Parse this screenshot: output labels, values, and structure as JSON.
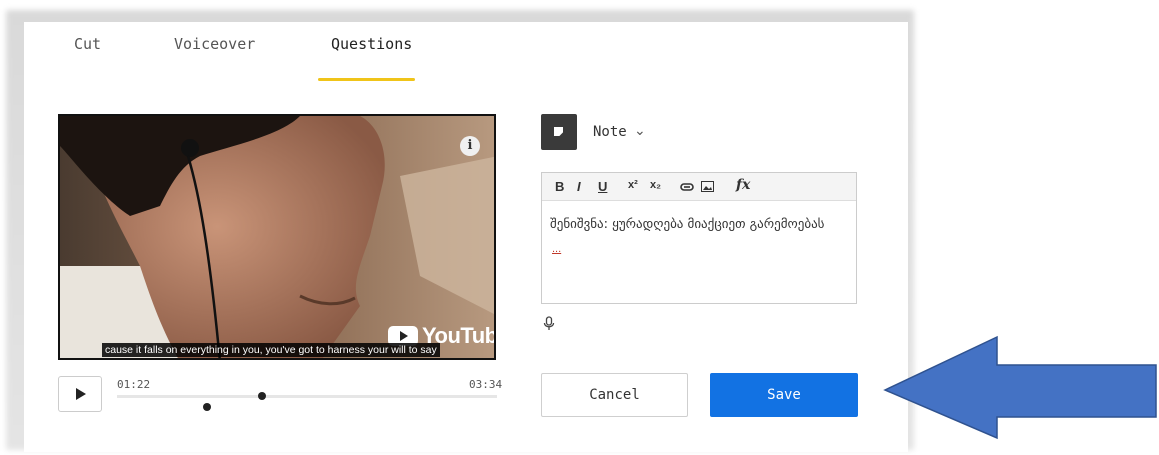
{
  "tabs": [
    {
      "label": "Cut",
      "active": false
    },
    {
      "label": "Voiceover",
      "active": false
    },
    {
      "label": "Questions",
      "active": true
    }
  ],
  "video": {
    "caption": "cause it falls on everything in you, you've got to harness your will to say",
    "youtube_label": "YouTube",
    "info_label": "i"
  },
  "player": {
    "current_time": "01:22",
    "total_time": "03:34"
  },
  "note": {
    "type_label": "Note",
    "toolbar": {
      "bold": "B",
      "italic": "I",
      "underline": "U",
      "superscript": "x²",
      "subscript": "x₂",
      "formula": "fx"
    },
    "text": "შენიშვნა: ყურადღება მიაქციეთ გარემოებას",
    "extra": "..."
  },
  "actions": {
    "cancel_label": "Cancel",
    "save_label": "Save"
  },
  "colors": {
    "accent_underline": "#f0c419",
    "save_button": "#1272e3",
    "arrow": "#4472c4"
  }
}
